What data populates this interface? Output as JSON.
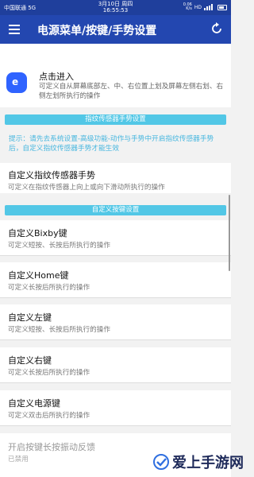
{
  "status": {
    "carrier": "中国联通 5G",
    "date": "3月10日 周四",
    "time": "16:55:53",
    "speed_value": "0.06",
    "speed_unit": "K/s",
    "net_type": "HD"
  },
  "appbar": {
    "title": "电源菜单/按键/手势设置"
  },
  "shortcut": {
    "icon_text": "e",
    "title": "点击进入",
    "subtitle": "可定义自从屏幕底部左、中、右位置上划及屏幕左侧右划、右侧左划所执行的操作"
  },
  "sections": {
    "fingerprint": "指纹传感器手势设置",
    "buttons": "自定义按键设置"
  },
  "hint": "提示：请先去系统设置-高级功能-动作与手势中开启指纹传感器手势后，自定义指纹传感器手势才能生效",
  "rows": [
    {
      "title": "自定义指纹传感器手势",
      "subtitle": "可定义在指纹传感器上向上或向下滑动所执行的操作"
    },
    {
      "title": "自定义Bixby键",
      "subtitle": "可定义短按、长按后所执行的操作"
    },
    {
      "title": "自定义Home键",
      "subtitle": "可定义长按后所执行的操作"
    },
    {
      "title": "自定义左键",
      "subtitle": "可定义短按、长按后所执行的操作"
    },
    {
      "title": "自定义右键",
      "subtitle": "可定义长按后所执行的操作"
    },
    {
      "title": "自定义电源键",
      "subtitle": "可定义双击后所执行的操作"
    },
    {
      "title": "开启按键长按振动反馈",
      "subtitle": "已禁用"
    }
  ],
  "watermark": "爱上手游网",
  "colors": {
    "appbar": "#2347b0",
    "section_bar": "#52c7e6",
    "hint": "#48b7df",
    "app_icon": "#2f63ff"
  }
}
